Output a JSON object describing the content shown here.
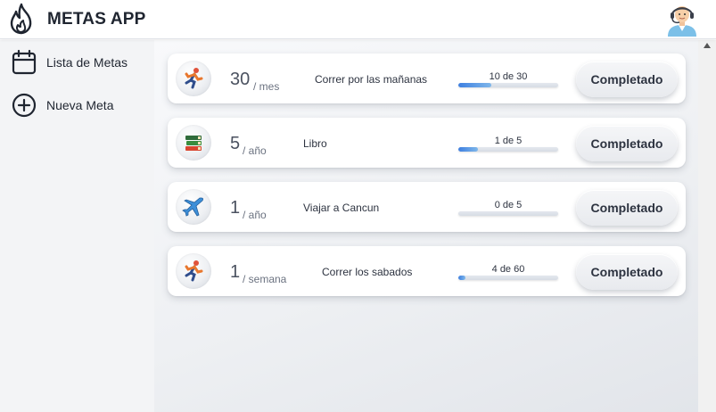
{
  "app": {
    "title": "METAS APP"
  },
  "header": {
    "logo_icon": "flame-icon",
    "avatar_icon": "support-agent-avatar"
  },
  "sidebar": {
    "items": [
      {
        "label": "Lista de Metas",
        "icon": "calendar-icon"
      },
      {
        "label": "Nueva Meta",
        "icon": "plus-circle-icon"
      }
    ]
  },
  "goals": [
    {
      "icon": "runner-icon",
      "count": "30",
      "period": "/ mes",
      "name": "Correr por las mañanas",
      "progress_text": "10 de 30",
      "progress": 0.333,
      "button": "Completado"
    },
    {
      "icon": "books-icon",
      "count": "5",
      "period": "/ año",
      "name": "Libro",
      "progress_text": "1 de 5",
      "progress": 0.2,
      "button": "Completado"
    },
    {
      "icon": "airplane-icon",
      "count": "1",
      "period": "/ año",
      "name": "Viajar a Cancun",
      "progress_text": "0 de 5",
      "progress": 0,
      "button": "Completado"
    },
    {
      "icon": "runner-icon",
      "count": "1",
      "period": "/ semana",
      "name": "Correr los sabados",
      "progress_text": "4 de 60",
      "progress": 0.067,
      "button": "Completado"
    }
  ],
  "colors": {
    "progress_fill": "#3d7fe0",
    "sidebar_bg": "#f3f4f6"
  }
}
